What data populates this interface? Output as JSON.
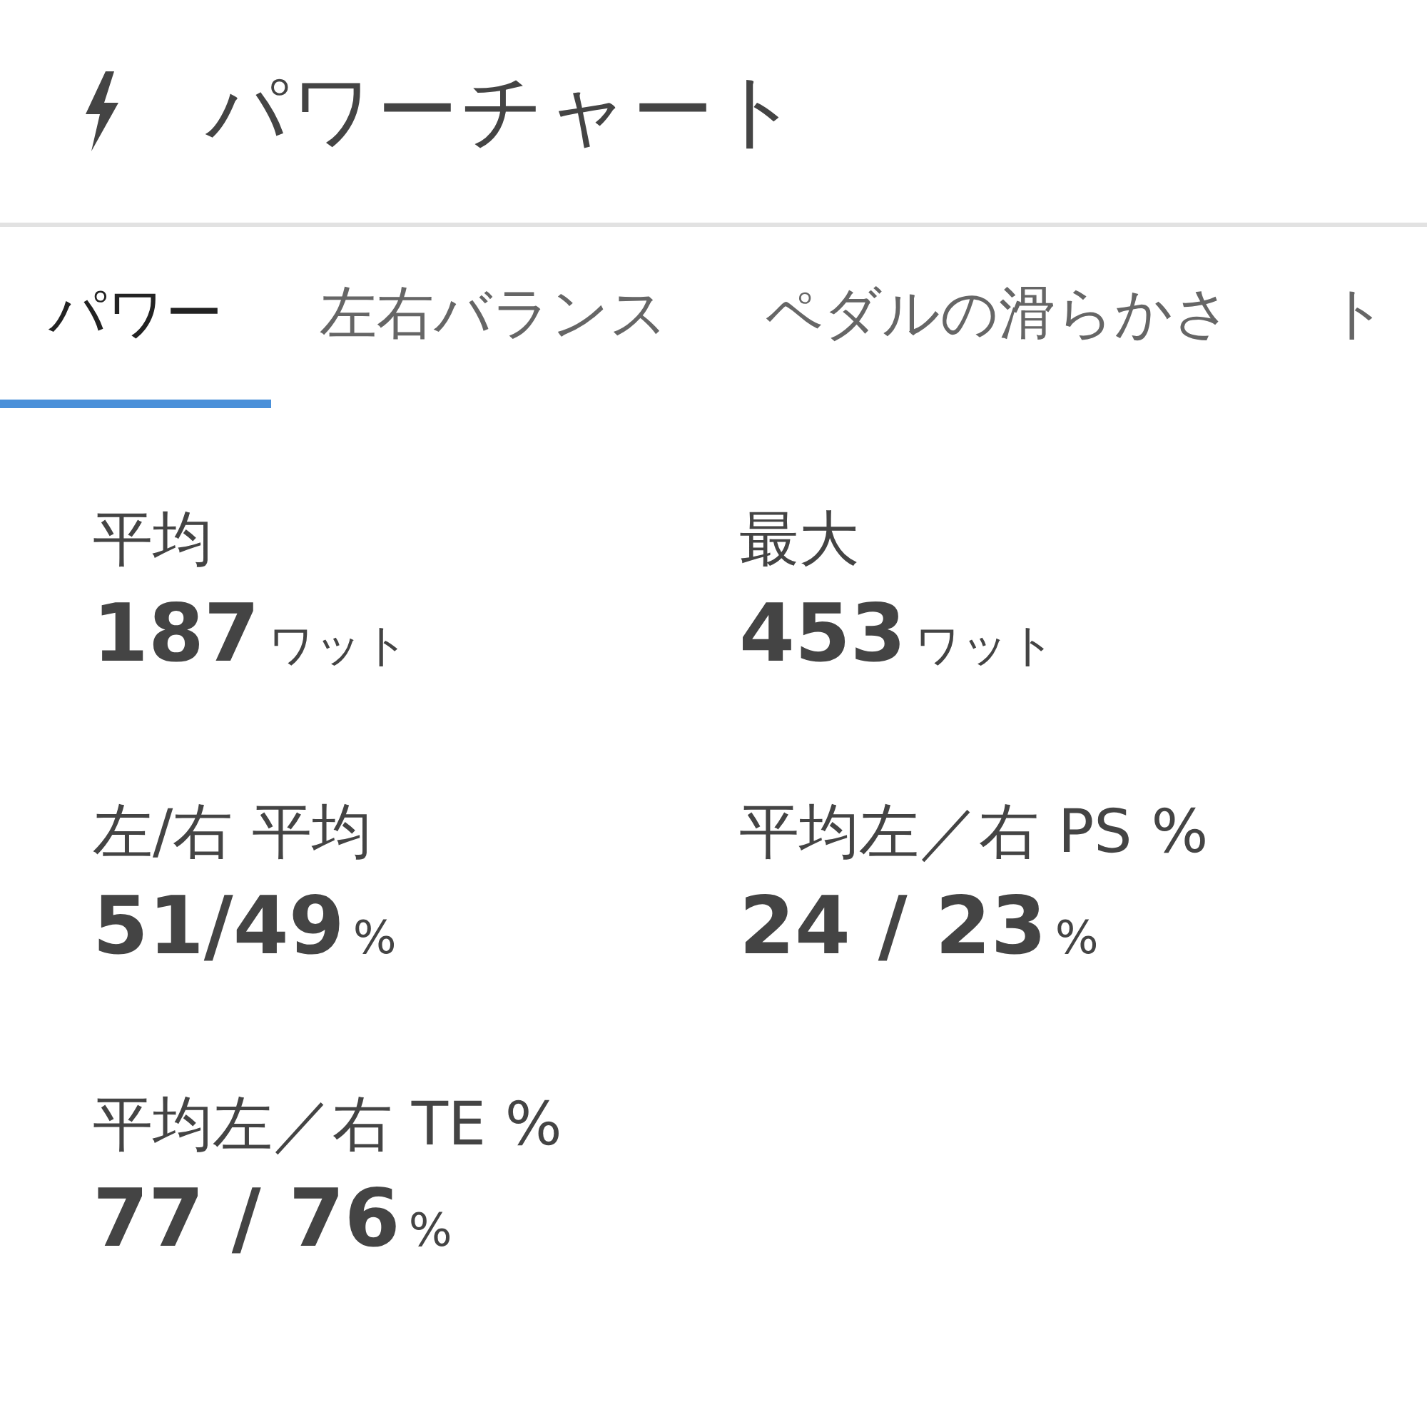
{
  "header": {
    "title": "パワーチャート"
  },
  "tabs": [
    {
      "label": "パワー",
      "selected": true
    },
    {
      "label": "左右バランス",
      "selected": false
    },
    {
      "label": "ペダルの滑らかさ",
      "selected": false
    },
    {
      "label": "ト",
      "selected": false
    }
  ],
  "stats": [
    {
      "label": "平均",
      "value": "187",
      "unit": "ワット"
    },
    {
      "label": "最大",
      "value": "453",
      "unit": "ワット"
    },
    {
      "label": "左/右 平均",
      "value": "51/49",
      "unit": "%"
    },
    {
      "label": "平均左／右 PS %",
      "value": "24 / 23",
      "unit": "%"
    },
    {
      "label": "平均左／右 TE %",
      "value": "77 / 76",
      "unit": "%"
    }
  ]
}
